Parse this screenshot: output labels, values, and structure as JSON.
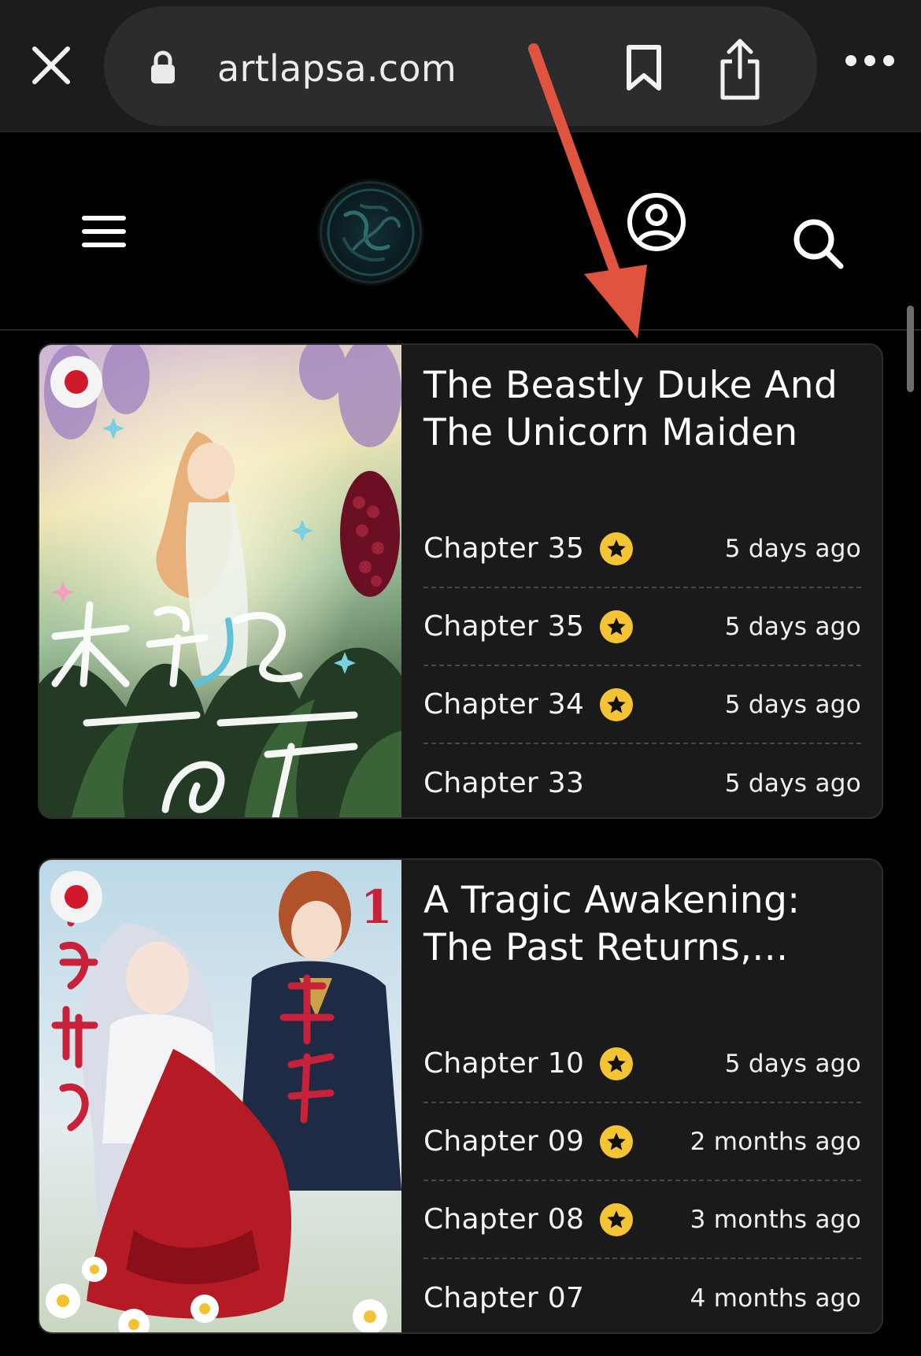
{
  "browser": {
    "url": "artlapsa.com"
  },
  "series": [
    {
      "title": "The Beastly Duke And The Unicorn Maiden",
      "flag": "japan-flag-icon",
      "chapters": [
        {
          "label": "Chapter 35",
          "star": true,
          "time": "5 days ago"
        },
        {
          "label": "Chapter 35",
          "star": true,
          "time": "5 days ago"
        },
        {
          "label": "Chapter 34",
          "star": true,
          "time": "5 days ago"
        },
        {
          "label": "Chapter 33",
          "star": false,
          "time": "5 days ago"
        }
      ]
    },
    {
      "title": "A Tragic Awakening: The Past Returns,...",
      "flag": "japan-flag-icon",
      "chapters": [
        {
          "label": "Chapter 10",
          "star": true,
          "time": "5 days ago"
        },
        {
          "label": "Chapter 09",
          "star": true,
          "time": "2 months ago"
        },
        {
          "label": "Chapter 08",
          "star": true,
          "time": "3 months ago"
        },
        {
          "label": "Chapter 07",
          "star": false,
          "time": "4 months ago"
        }
      ]
    }
  ],
  "colors": {
    "background": "#000000",
    "card": "#1a1a1a",
    "star": "#f4c434",
    "annotation_arrow": "#e0533f",
    "flag_red": "#d1192c"
  }
}
